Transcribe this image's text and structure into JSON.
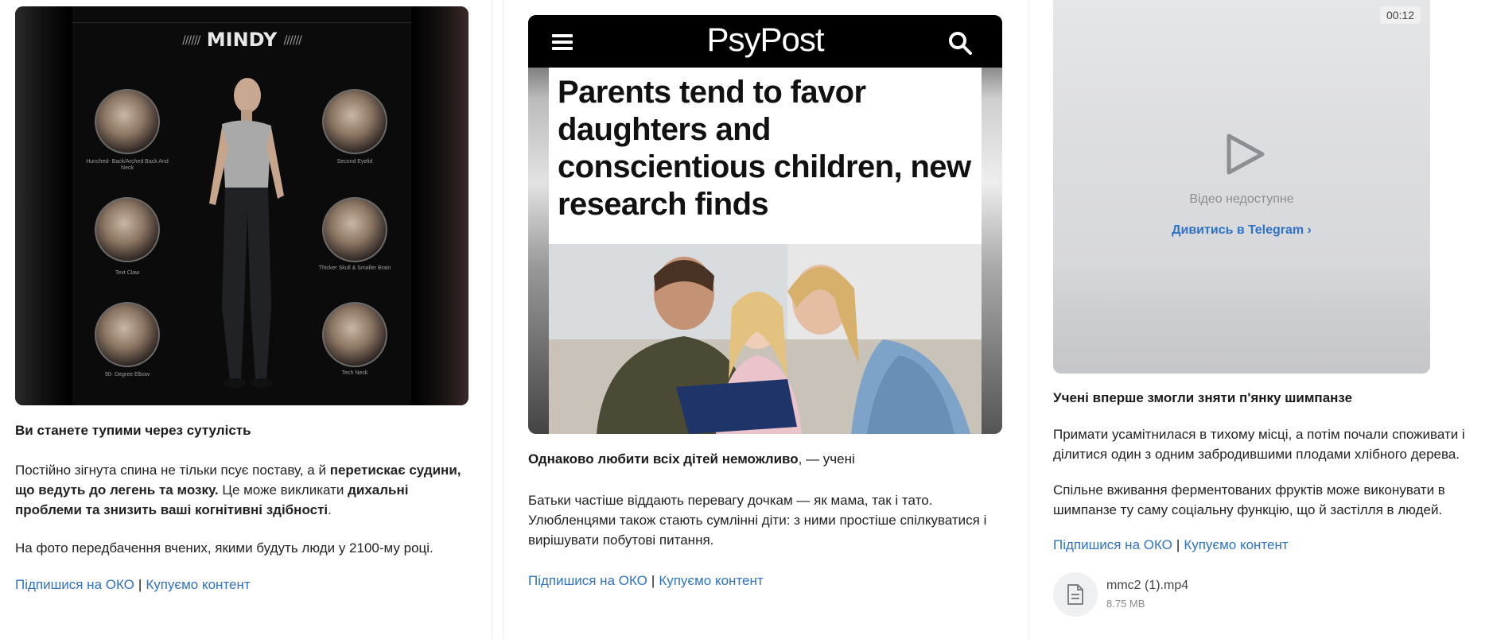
{
  "posts": [
    {
      "image": {
        "brand": "MINDY",
        "brand_hatch": "//////",
        "labels": {
          "top_left": "Hunched- Back/Arched Back And Neck",
          "top_right": "Second Eyelid",
          "mid_left": "Text Claw",
          "mid_right": "Thicker Skull & Smaller Brain",
          "bot_left": "90- Degree Elbow",
          "bot_right": "Tech Neck"
        }
      },
      "title": "Ви станете тупими через сутулість",
      "para1_a": "Постійно зігнута спина не тільки псує поставу, а й ",
      "para1_b": "перетискає судини, що ведуть до легень та мозку.",
      "para1_c": " Це може викликати ",
      "para1_d": "дихальні проблеми та знизить ваші когнітивні здібності",
      "para1_e": ".",
      "para2": "На фото передбачення вчених, якими будуть люди у 2100-му році.",
      "link_subscribe": "Підпишися на ОКО",
      "link_separator": "|",
      "link_buy": "Купуємо контент"
    },
    {
      "image": {
        "logo": "PsyPost",
        "headline": "Parents tend to favor daughters and conscientious children, new research finds"
      },
      "title_bold": "Однаково любити всіх дітей неможливо",
      "title_rest": ", — учені",
      "para1": "Батьки частіше віддають перевагу дочкам — як мама, так і тато. Улюбленцями також стають сумлінні діти: з ними простіше спілкуватися і вирішувати побутові питання.",
      "link_subscribe": "Підпишися на ОКО",
      "link_separator": "|",
      "link_buy": "Купуємо контент"
    },
    {
      "video": {
        "duration": "00:12",
        "unavailable": "Відео недоступне",
        "open_in_telegram": "Дивитись в Telegram ›"
      },
      "title": "Учені вперше змогли зняти п'янку шимпанзе",
      "para1": "Примати усамітнилася в тихому місці, а потім почали споживати і ділитися один з одним забродившими плодами хлібного дерева.",
      "para2": "Спільне вживання ферментованих фруктів може виконувати в шимпанзе ту саму соціальну функцію, що й застілля в людей.",
      "link_subscribe": "Підпишися на ОКО",
      "link_separator": "|",
      "link_buy": "Купуємо контент",
      "file": {
        "name": "mmc2 (1).mp4",
        "size": "8.75 MB"
      }
    }
  ],
  "colors": {
    "link": "#2f72c6",
    "text": "#1a1a1a",
    "divider": "#ececec"
  }
}
